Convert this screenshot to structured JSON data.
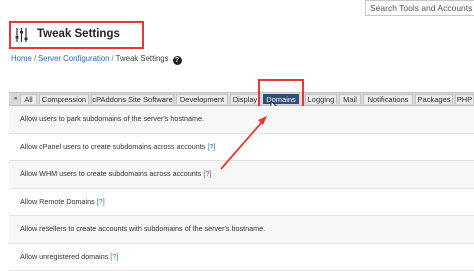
{
  "search": {
    "text": "Search Tools and Accounts (/"
  },
  "header": {
    "title": "Tweak Settings",
    "icon": "sliders-icon"
  },
  "breadcrumb": {
    "home": "Home",
    "section": "Server Configuration",
    "current": "Tweak Settings",
    "separator": "/",
    "help": "?"
  },
  "tabs": {
    "scroll_left": "◂",
    "items": [
      "All",
      "Compression",
      "cPAddons Site Software",
      "Development",
      "Display",
      "Domains",
      "Logging",
      "Mail",
      "Notifications",
      "Packages",
      "PHP"
    ],
    "active": "Domains"
  },
  "rows": [
    {
      "text": "Allow users to park subdomains of the server's hostname.",
      "link": ""
    },
    {
      "text": "Allow cPanel users to create subdomains across accounts",
      "link": "[?]"
    },
    {
      "text": "Allow WHM users to create subdomains across accounts",
      "link": "[?]"
    },
    {
      "text": "Allow Remote Domains",
      "link": "[?]"
    },
    {
      "text": "Allow resellers to create accounts with subdomains of the server's hostname.",
      "link": ""
    },
    {
      "text": "Allow unregistered domains",
      "link": "[?]"
    }
  ],
  "colors": {
    "annotation_red": "#e53935",
    "active_tab": "#2c4e78",
    "link": "#2a6ebb"
  }
}
